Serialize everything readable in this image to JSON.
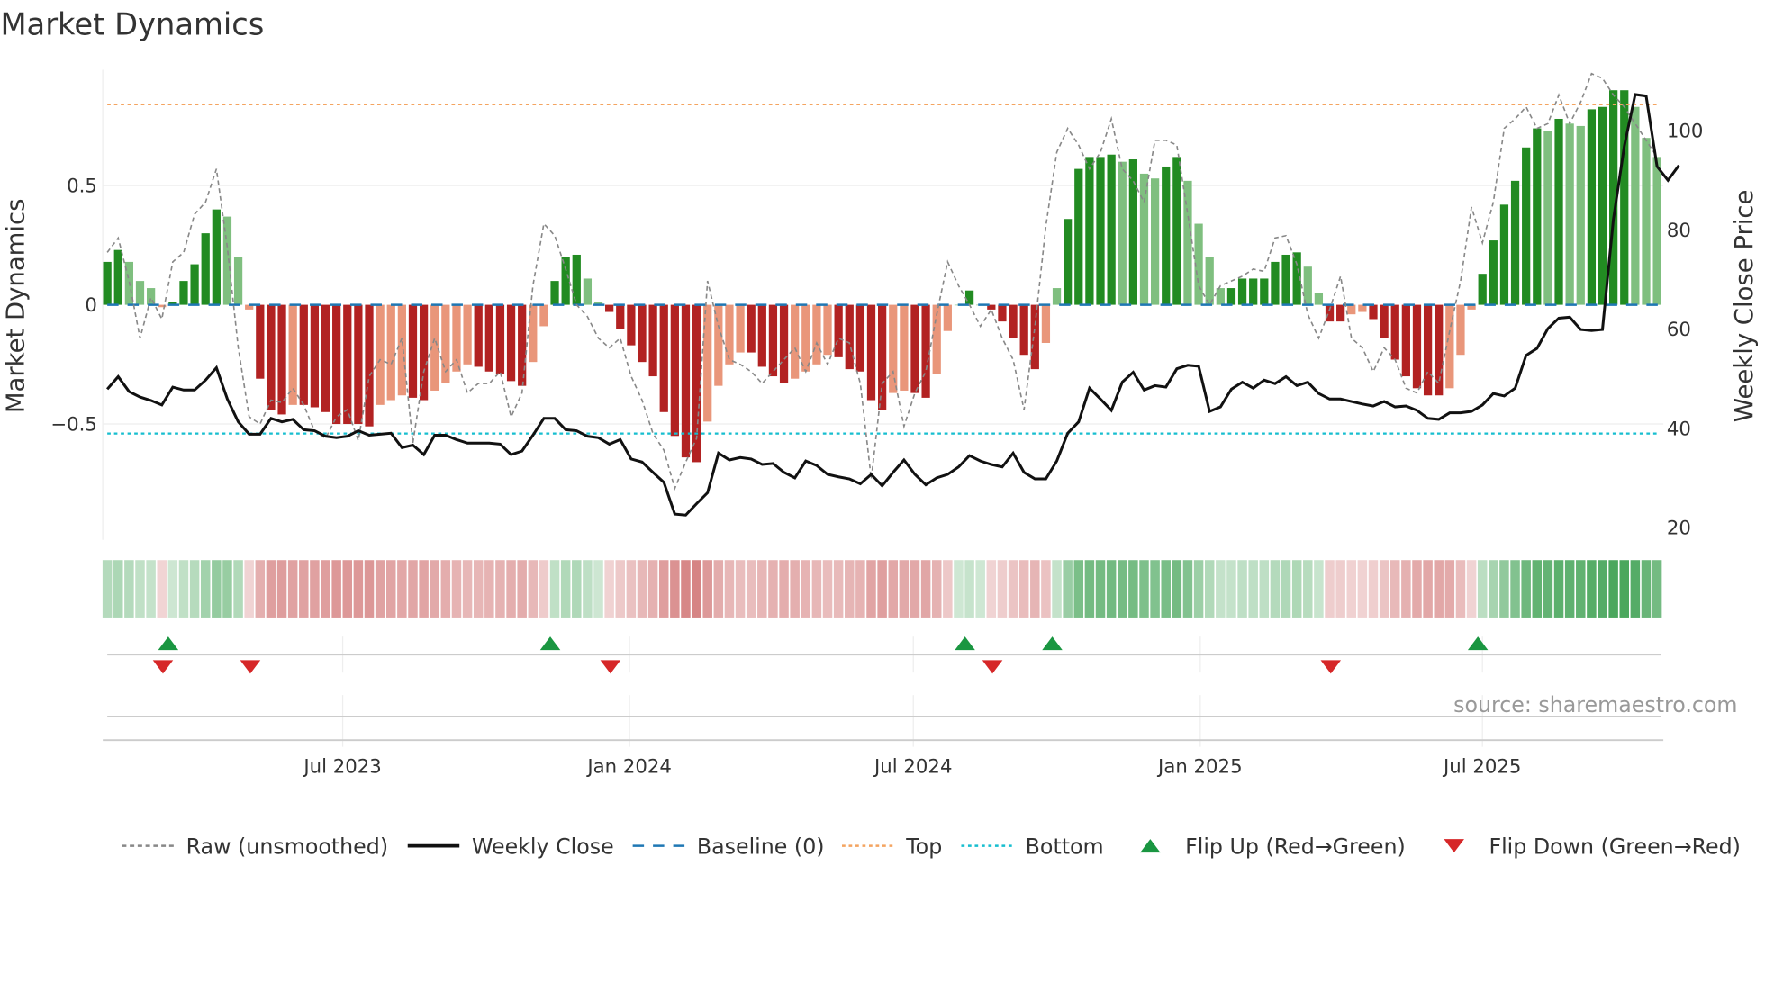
{
  "chart_data": {
    "type": "bar",
    "title": "Market Dynamics",
    "ylabel": "Market Dynamics",
    "y2label": "Weekly Close Price",
    "ylim": [
      -0.95,
      0.98
    ],
    "y2lim": [
      18,
      112
    ],
    "frequency": "weekly",
    "start_date": "2023-01-31",
    "yticks": [
      {
        "value": 0.5,
        "label": "0.5"
      },
      {
        "value": 0,
        "label": "0"
      },
      {
        "value": -0.5,
        "label": "−0.5"
      }
    ],
    "y2ticks": [
      {
        "value": 100,
        "label": "100"
      },
      {
        "value": 80,
        "label": "80"
      },
      {
        "value": 60,
        "label": "60"
      },
      {
        "value": 40,
        "label": "40"
      },
      {
        "value": 20,
        "label": "20"
      }
    ],
    "xticks": [
      {
        "date": "2023-07-01",
        "label": "Jul 2023"
      },
      {
        "date": "2024-01-01",
        "label": "Jan 2024"
      },
      {
        "date": "2024-07-01",
        "label": "Jul 2024"
      },
      {
        "date": "2025-01-01",
        "label": "Jan 2025"
      },
      {
        "date": "2025-07-01",
        "label": "Jul 2025"
      }
    ],
    "top_level": 0.84,
    "bottom_level": -0.54,
    "baseline": 0,
    "smoothed": [
      0.18,
      0.23,
      0.18,
      0.1,
      0.07,
      -0.01,
      0.01,
      0.1,
      0.17,
      0.3,
      0.4,
      0.37,
      0.2,
      -0.02,
      -0.31,
      -0.44,
      -0.46,
      -0.42,
      -0.42,
      -0.43,
      -0.45,
      -0.5,
      -0.5,
      -0.5,
      -0.51,
      -0.42,
      -0.4,
      -0.38,
      -0.39,
      -0.4,
      -0.36,
      -0.33,
      -0.28,
      -0.25,
      -0.26,
      -0.28,
      -0.29,
      -0.32,
      -0.34,
      -0.24,
      -0.09,
      0.1,
      0.2,
      0.21,
      0.11,
      0.01,
      -0.03,
      -0.1,
      -0.17,
      -0.24,
      -0.3,
      -0.45,
      -0.55,
      -0.64,
      -0.66,
      -0.49,
      -0.34,
      -0.25,
      -0.2,
      -0.2,
      -0.26,
      -0.3,
      -0.33,
      -0.31,
      -0.28,
      -0.25,
      -0.21,
      -0.22,
      -0.27,
      -0.28,
      -0.4,
      -0.44,
      -0.37,
      -0.36,
      -0.37,
      -0.39,
      -0.29,
      -0.11,
      0.0,
      0.06,
      0.0,
      -0.02,
      -0.07,
      -0.14,
      -0.21,
      -0.27,
      -0.16,
      0.07,
      0.36,
      0.57,
      0.62,
      0.62,
      0.63,
      0.6,
      0.61,
      0.55,
      0.53,
      0.58,
      0.62,
      0.52,
      0.34,
      0.2,
      0.07,
      0.07,
      0.11,
      0.11,
      0.11,
      0.18,
      0.21,
      0.22,
      0.16,
      0.05,
      -0.07,
      -0.07,
      -0.04,
      -0.03,
      -0.06,
      -0.14,
      -0.23,
      -0.3,
      -0.35,
      -0.38,
      -0.38,
      -0.35,
      -0.21,
      -0.02,
      0.13,
      0.27,
      0.42,
      0.52,
      0.66,
      0.74,
      0.73,
      0.78,
      0.76,
      0.75,
      0.82,
      0.83,
      0.9,
      0.9,
      0.83,
      0.7,
      0.62
    ],
    "raw": [
      0.22,
      0.28,
      0.1,
      -0.14,
      0.03,
      -0.06,
      0.18,
      0.22,
      0.38,
      0.43,
      0.57,
      0.24,
      -0.18,
      -0.47,
      -0.5,
      -0.4,
      -0.41,
      -0.35,
      -0.42,
      -0.53,
      -0.56,
      -0.47,
      -0.44,
      -0.57,
      -0.3,
      -0.23,
      -0.25,
      -0.14,
      -0.58,
      -0.28,
      -0.14,
      -0.28,
      -0.23,
      -0.37,
      -0.33,
      -0.33,
      -0.28,
      -0.47,
      -0.37,
      0.08,
      0.34,
      0.29,
      0.15,
      0.0,
      -0.05,
      -0.14,
      -0.18,
      -0.14,
      -0.3,
      -0.4,
      -0.54,
      -0.61,
      -0.77,
      -0.66,
      -0.56,
      0.1,
      -0.09,
      -0.23,
      -0.25,
      -0.28,
      -0.33,
      -0.28,
      -0.23,
      -0.18,
      -0.28,
      -0.16,
      -0.25,
      -0.14,
      -0.16,
      -0.33,
      -0.73,
      -0.33,
      -0.28,
      -0.51,
      -0.37,
      -0.28,
      -0.04,
      0.18,
      0.08,
      0.0,
      -0.09,
      -0.02,
      -0.14,
      -0.23,
      -0.44,
      -0.09,
      0.33,
      0.64,
      0.74,
      0.67,
      0.57,
      0.64,
      0.78,
      0.57,
      0.52,
      0.43,
      0.69,
      0.69,
      0.67,
      0.38,
      0.08,
      0.0,
      0.08,
      0.1,
      0.12,
      0.15,
      0.14,
      0.28,
      0.29,
      0.17,
      -0.04,
      -0.14,
      -0.02,
      0.12,
      -0.14,
      -0.18,
      -0.28,
      -0.18,
      -0.23,
      -0.35,
      -0.37,
      -0.28,
      -0.33,
      -0.11,
      0.1,
      0.41,
      0.26,
      0.43,
      0.74,
      0.78,
      0.83,
      0.74,
      0.76,
      0.88,
      0.76,
      0.85,
      0.97,
      0.95,
      0.88,
      0.83,
      0.76,
      0.69,
      0.62
    ],
    "close": [
      47.9,
      50.4,
      47.4,
      46.3,
      45.6,
      44.7,
      48.3,
      47.7,
      47.7,
      49.7,
      52.2,
      45.9,
      41.3,
      38.8,
      38.8,
      42.0,
      41.3,
      41.8,
      39.7,
      39.5,
      38.4,
      38.1,
      38.4,
      39.5,
      38.6,
      38.8,
      39.0,
      36.1,
      36.6,
      34.7,
      38.6,
      38.6,
      37.7,
      37.0,
      37.0,
      37.0,
      36.8,
      34.7,
      35.4,
      38.6,
      42.0,
      42.0,
      39.7,
      39.5,
      38.4,
      38.1,
      36.8,
      37.7,
      33.8,
      33.2,
      31.1,
      29.1,
      22.7,
      22.5,
      24.8,
      27.0,
      35.0,
      33.6,
      34.1,
      33.8,
      32.7,
      32.9,
      31.1,
      30.0,
      33.4,
      32.5,
      30.7,
      30.2,
      29.8,
      28.8,
      30.7,
      28.4,
      31.1,
      33.6,
      30.7,
      28.6,
      30.0,
      30.7,
      32.2,
      34.5,
      33.4,
      32.7,
      32.2,
      35.0,
      31.1,
      29.8,
      29.8,
      33.4,
      39.0,
      41.3,
      48.1,
      45.9,
      43.6,
      49.3,
      51.3,
      47.7,
      48.6,
      48.3,
      52.0,
      52.7,
      52.5,
      43.4,
      44.3,
      47.9,
      49.3,
      48.1,
      49.7,
      49.0,
      50.4,
      48.6,
      49.3,
      47.0,
      45.9,
      45.9,
      45.4,
      44.9,
      44.5,
      45.4,
      44.3,
      44.5,
      43.6,
      42.0,
      41.8,
      43.1,
      43.1,
      43.4,
      44.7,
      47.0,
      46.5,
      48.1,
      54.7,
      56.1,
      60.1,
      62.2,
      62.4,
      59.9,
      59.7,
      59.9,
      82.1,
      96.9,
      107.3,
      107.0,
      92.8,
      90.0,
      93.0
    ],
    "flip_up_weeks": [
      6,
      41,
      79,
      87,
      126
    ],
    "flip_down_weeks": [
      5,
      13,
      46,
      81,
      112
    ],
    "legend": [
      {
        "label": "Raw (unsmoothed)",
        "style": "dashed",
        "color": "#888888"
      },
      {
        "label": "Weekly Close",
        "style": "solid",
        "color": "#111111"
      },
      {
        "label": "Baseline (0)",
        "style": "dashed",
        "color": "#1f77b4"
      },
      {
        "label": "Top",
        "style": "dotted",
        "color": "#f4a460"
      },
      {
        "label": "Bottom",
        "style": "dotted",
        "color": "#17becf"
      },
      {
        "label": "Flip Up (Red→Green)",
        "style": "triangle-up",
        "color": "#1a9641"
      },
      {
        "label": "Flip Down (Green→Red)",
        "style": "triangle-down",
        "color": "#d62728"
      }
    ],
    "legend_position": "bottom",
    "colors": {
      "green_strong": "#228b22",
      "green_weak": "#7fbf7f",
      "red_strong": "#b22222",
      "red_weak": "#e9967a"
    }
  },
  "source": "source: sharemaestro.com"
}
